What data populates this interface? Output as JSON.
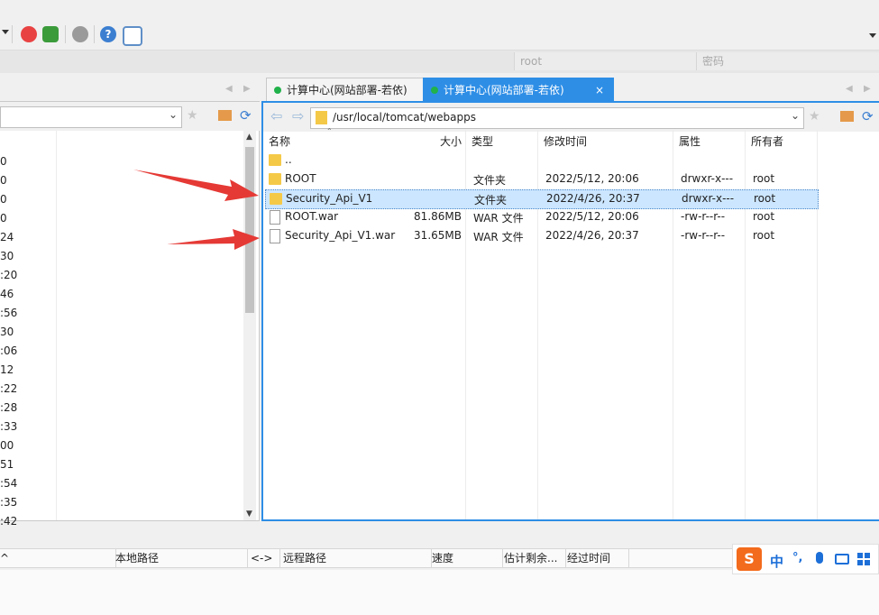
{
  "login": {
    "user": "root",
    "password_placeholder": "密码"
  },
  "tabs": [
    {
      "label": "计算中心(网站部署-若依)",
      "active": false
    },
    {
      "label": "计算中心(网站部署-若依)",
      "active": true,
      "close": "×"
    }
  ],
  "left_pane": {
    "times": [
      "0",
      "0",
      "0",
      "0",
      "24",
      "30",
      ":20",
      "46",
      ":56",
      "30",
      ":06",
      "12",
      ":22",
      ":28",
      ":33",
      "00",
      "51",
      ":54",
      ":35",
      ":42"
    ]
  },
  "right_pane": {
    "path": "/usr/local/tomcat/webapps",
    "columns": {
      "name": "名称",
      "size": "大小",
      "type": "类型",
      "modified": "修改时间",
      "attr": "属性",
      "owner": "所有者"
    },
    "rows": [
      {
        "icon": "folder-icon",
        "name": "..",
        "size": "",
        "type": "",
        "modified": "",
        "attr": "",
        "owner": "",
        "selected": false
      },
      {
        "icon": "folder-icon",
        "name": "ROOT",
        "size": "",
        "type": "文件夹",
        "modified": "2022/5/12, 20:06",
        "attr": "drwxr-x---",
        "owner": "root",
        "selected": false
      },
      {
        "icon": "folder-icon",
        "name": "Security_Api_V1",
        "size": "",
        "type": "文件夹",
        "modified": "2022/4/26, 20:37",
        "attr": "drwxr-x---",
        "owner": "root",
        "selected": true
      },
      {
        "icon": "file-icon",
        "name": "ROOT.war",
        "size": "81.86MB",
        "type": "WAR 文件",
        "modified": "2022/5/12, 20:06",
        "attr": "-rw-r--r--",
        "owner": "root",
        "selected": false
      },
      {
        "icon": "file-icon",
        "name": "Security_Api_V1.war",
        "size": "31.65MB",
        "type": "WAR 文件",
        "modified": "2022/4/26, 20:37",
        "attr": "-rw-r--r--",
        "owner": "root",
        "selected": false
      }
    ]
  },
  "transfer": {
    "headers": [
      "^",
      "本地路径",
      "<->",
      "远程路径",
      "速度",
      "估计剩余...",
      "经过时间"
    ]
  },
  "ime": {
    "lang": "中",
    "punct": "°,"
  }
}
